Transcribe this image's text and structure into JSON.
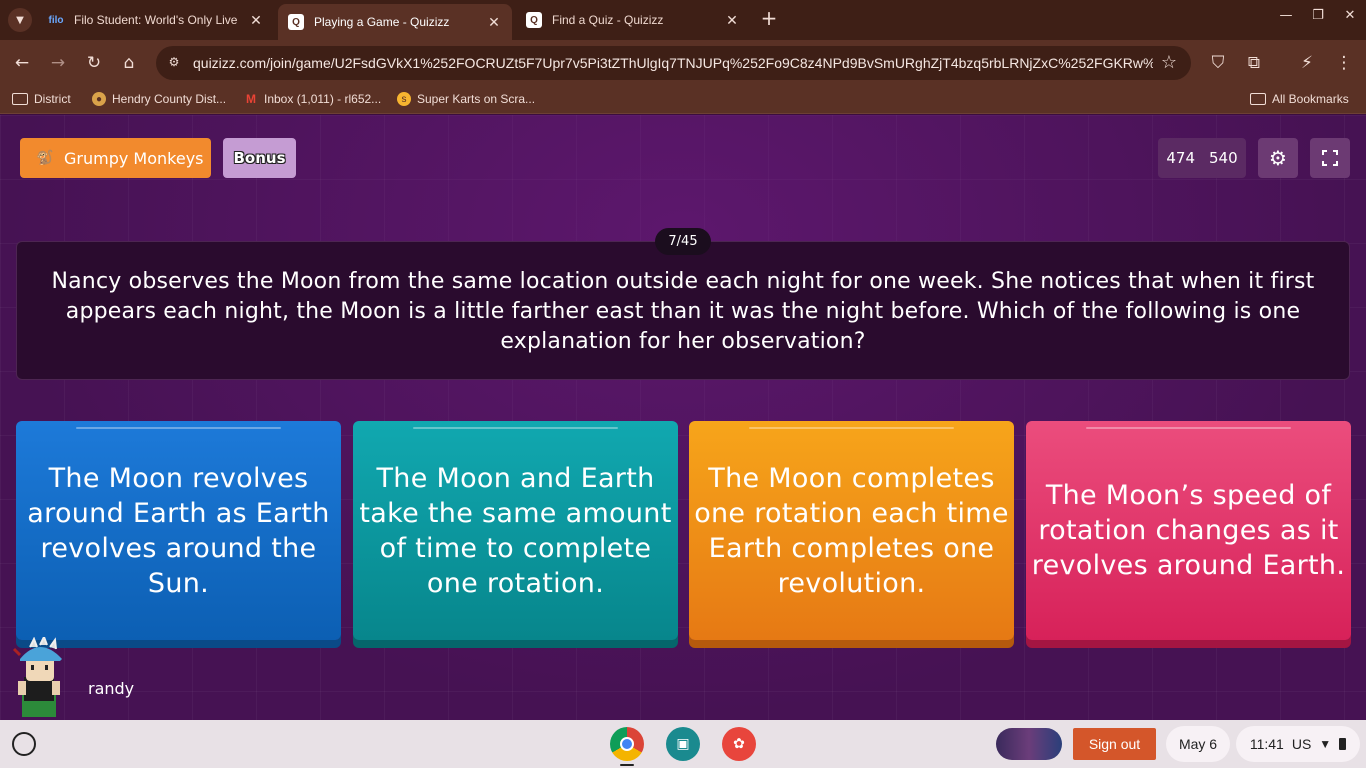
{
  "browser": {
    "tabs": [
      {
        "title": "Filo Student: World's Only Live",
        "favicon": "filo-icon",
        "active": false
      },
      {
        "title": "Playing a Game - Quizizz",
        "favicon": "quizizz-icon",
        "active": true
      },
      {
        "title": "Find a Quiz - Quizizz",
        "favicon": "quizizz-icon",
        "active": false
      }
    ],
    "url": "quizizz.com/join/game/U2FsdGVkX1%252FOCRUZt5F7Upr7v5Pi3tZThUlgIq7TNJUPq%252Fo9C8z4NPd9BvSmURghZjT4bzq5rbLRNjZxC%252FGKRw%...",
    "bookmarks": [
      {
        "label": "District",
        "icon": "folder-icon"
      },
      {
        "label": "Hendry County Dist...",
        "icon": "district-logo-icon"
      },
      {
        "label": "Inbox (1,011) - rl652...",
        "icon": "gmail-icon"
      },
      {
        "label": "Super Karts on Scra...",
        "icon": "scratch-icon"
      }
    ],
    "all_bookmarks": "All Bookmarks"
  },
  "game": {
    "team_name": "Grumpy Monkeys",
    "bonus_label": "Bonus",
    "score_a": "474",
    "score_b": "540",
    "counter": "7/45",
    "question": "Nancy observes the Moon from the same location outside each night for one week. She notices that when it first appears each night, the Moon is a little farther east than it was the night before. Which of the following is one explanation for her observation?",
    "options": [
      {
        "text": "The Moon revolves around Earth as Earth revolves around the Sun.",
        "color": "#1272cd"
      },
      {
        "text": "The Moon and Earth take the same amount of time to complete one rotation.",
        "color": "#0a9aa1"
      },
      {
        "text": "The Moon completes one rotation each time Earth completes one revolution.",
        "color": "#f28c17"
      },
      {
        "text": "The Moon’s speed of rotation changes as it revolves around Earth.",
        "color": "#e03669"
      }
    ],
    "player_name": "randy"
  },
  "shelf": {
    "sign_out": "Sign out",
    "date": "May 6",
    "time": "11:41",
    "locale": "US"
  }
}
